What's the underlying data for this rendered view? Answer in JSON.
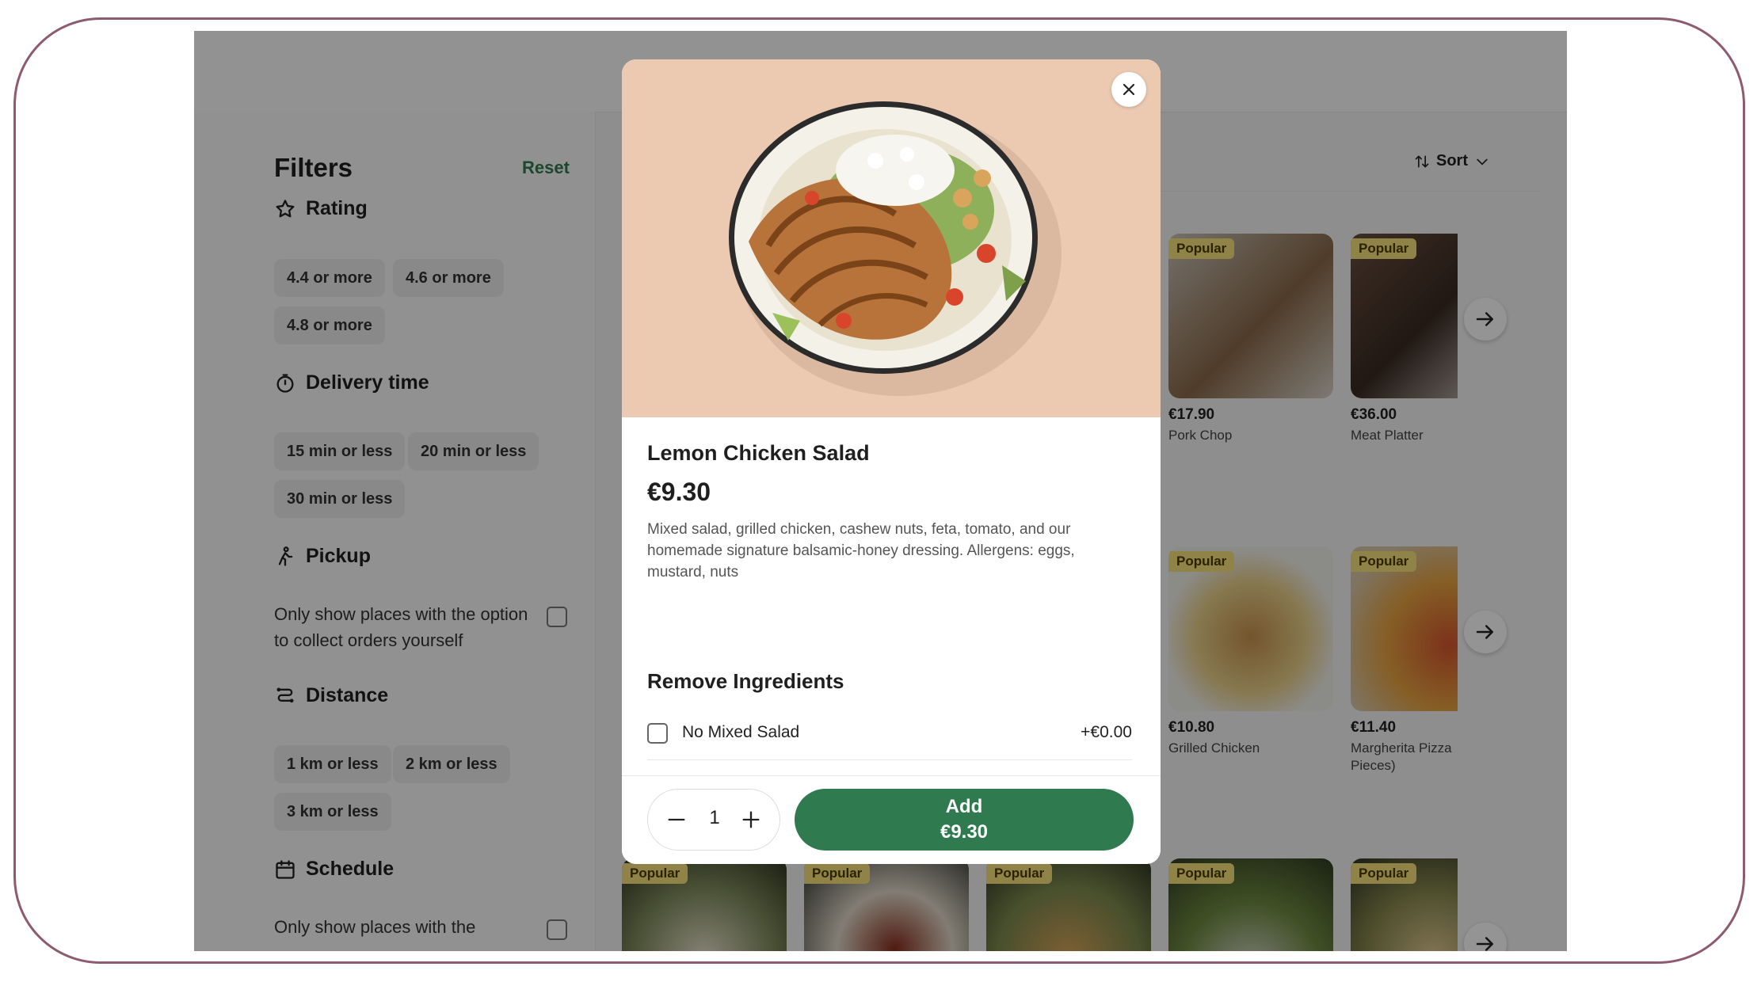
{
  "filters": {
    "title": "Filters",
    "reset": "Reset",
    "rating": {
      "title": "Rating",
      "chips": [
        "4.4 or more",
        "4.6 or more",
        "4.8 or more"
      ]
    },
    "delivery": {
      "title": "Delivery time",
      "chips": [
        "15 min or less",
        "20 min or less",
        "30 min or less"
      ]
    },
    "pickup": {
      "title": "Pickup",
      "text": "Only show places with the option to collect orders yourself"
    },
    "distance": {
      "title": "Distance",
      "chips": [
        "1 km or less",
        "2 km or less",
        "3 km or less"
      ]
    },
    "schedule": {
      "title": "Schedule",
      "text": "Only show places with the"
    }
  },
  "sort": {
    "label": "Sort"
  },
  "badge": "Popular",
  "cards_row1": [
    {
      "price": "€17.90",
      "name": "Pork Chop",
      "color": "#8a7a6a"
    },
    {
      "price": "€36.00",
      "name": "Meat Platter",
      "color": "#4a3a30"
    }
  ],
  "cards_row2": [
    {
      "price": "€10.80",
      "name": "Grilled Chicken",
      "color": "#b6864a"
    },
    {
      "price": "€11.40",
      "name": "Margherita Pizza",
      "name2": "Pieces)",
      "color": "#c9893f"
    }
  ],
  "modal": {
    "title": "Lemon Chicken Salad",
    "price": "€9.30",
    "description": "Mixed salad, grilled chicken, cashew nuts, feta, tomato, and our homemade signature balsamic-honey dressing. Allergens: eggs, mustard, nuts",
    "section": "Remove Ingredients",
    "ingredient": {
      "name": "No Mixed Salad",
      "price": "+€0.00"
    },
    "quantity": "1",
    "add_label": "Add",
    "add_price": "€9.30"
  }
}
